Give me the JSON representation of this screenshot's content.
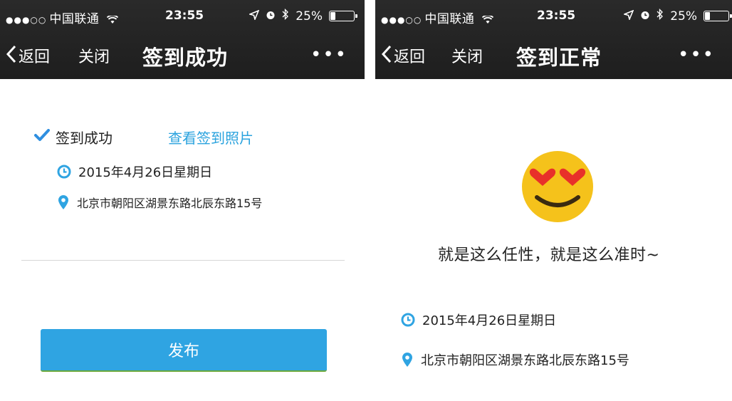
{
  "status_bar": {
    "signal_dots": "●●●○○",
    "carrier": "中国联通",
    "time": "23:55",
    "battery": "25%",
    "battery_level": 0.25
  },
  "nav": {
    "back_label": "返回",
    "close_label": "关闭",
    "more_label": "•••"
  },
  "left_screen": {
    "title": "签到成功",
    "status_label": "签到成功",
    "view_photos_link": "查看签到照片",
    "date": "2015年4月26日星期日",
    "address": "北京市朝阳区湖景东路北辰东路15号",
    "publish_button": "发布"
  },
  "right_screen": {
    "title": "签到正常",
    "tagline": "就是这么任性，就是这么准时~",
    "date": "2015年4月26日星期日",
    "address": "北京市朝阳区湖景东路北辰东路15号"
  },
  "colors": {
    "header_bg": "#222222",
    "accent_blue": "#2fa4e2",
    "link_blue": "#2ba3de",
    "emoji_yellow": "#f5c21b",
    "heart_red": "#e8302a"
  },
  "icons": [
    "location-arrow-icon",
    "alarm-icon",
    "bluetooth-icon",
    "battery-icon",
    "chevron-left-icon",
    "more-icon",
    "check-icon",
    "clock-icon",
    "location-pin-icon",
    "heart-eyes-emoji"
  ]
}
